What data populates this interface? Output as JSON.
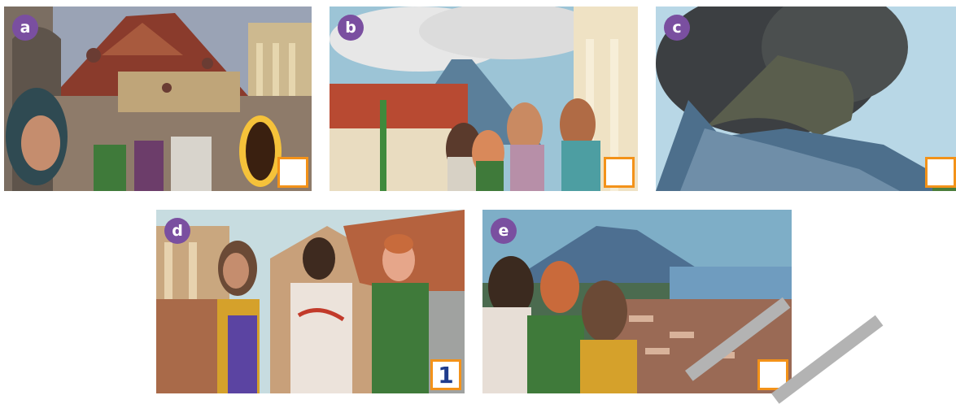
{
  "colors": {
    "label_circle": "#7a4fa0",
    "answer_border": "#f39219",
    "answer_text": "#1f3c8c"
  },
  "panels": [
    {
      "label": "a",
      "answer": "",
      "scene": "volcano-eruption-city-portal"
    },
    {
      "label": "b",
      "answer": "",
      "scene": "characters-with-roman-citizens"
    },
    {
      "label": "c",
      "answer": "",
      "scene": "volcano-ash-cloud"
    },
    {
      "label": "d",
      "answer": "1",
      "scene": "three-children-in-roman-street"
    },
    {
      "label": "e",
      "answer": "",
      "scene": "children-viewing-city-and-volcano"
    }
  ]
}
